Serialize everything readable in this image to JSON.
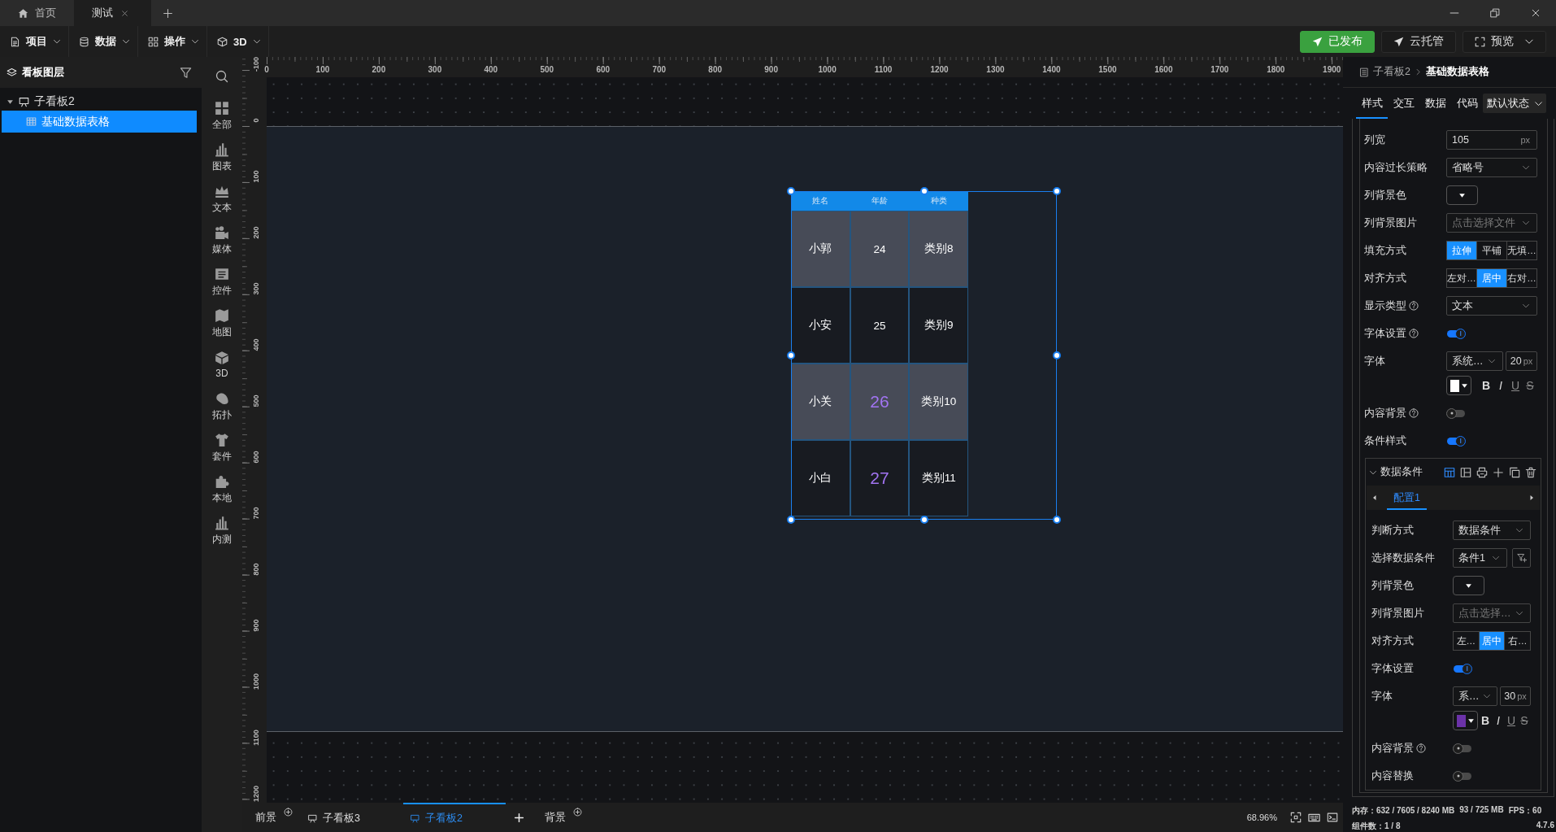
{
  "title_bar": {
    "tabs": [
      {
        "label": "首页",
        "selected": false,
        "closable": false
      },
      {
        "label": "测试",
        "selected": true,
        "closable": true
      }
    ]
  },
  "toolbar": {
    "menus": [
      {
        "label": "项目"
      },
      {
        "label": "数据"
      },
      {
        "label": "操作"
      },
      {
        "label": "3D"
      }
    ],
    "actions": [
      {
        "label": "已发布",
        "kind": "primary"
      },
      {
        "label": "云托管",
        "kind": "plain"
      },
      {
        "label": "预览",
        "kind": "dropdown"
      }
    ]
  },
  "layers_panel": {
    "title": "看板图层",
    "tree": [
      {
        "label": "子看板2",
        "expanded": true,
        "selected": false,
        "children": [
          {
            "label": "基础数据表格",
            "selected": true
          }
        ]
      }
    ]
  },
  "component_bar": {
    "items": [
      {
        "label": "全部"
      },
      {
        "label": "图表"
      },
      {
        "label": "文本"
      },
      {
        "label": "媒体"
      },
      {
        "label": "控件"
      },
      {
        "label": "地图"
      },
      {
        "label": "3D"
      },
      {
        "label": "拓扑"
      },
      {
        "label": "套件"
      },
      {
        "label": "本地"
      },
      {
        "label": "内测"
      }
    ]
  },
  "rulers": {
    "horizontal": [
      "0",
      "100",
      "200",
      "300",
      "400",
      "500",
      "600",
      "700",
      "800",
      "900",
      "1000",
      "1100",
      "1200",
      "1300",
      "1400",
      "1500",
      "1600",
      "1700",
      "1800",
      "1900"
    ],
    "vertical": [
      "-100",
      "0",
      "100",
      "200",
      "300",
      "400",
      "500",
      "600",
      "700",
      "800",
      "900",
      "1000",
      "1100",
      "1200"
    ]
  },
  "canvas": {
    "table": {
      "selected": true,
      "columns": [
        "姓名",
        "年龄",
        "种类"
      ],
      "rows": [
        {
          "cells": [
            {
              "text": "小郭",
              "conditional": false
            },
            {
              "text": "24",
              "conditional": false
            },
            {
              "text": "类别8",
              "conditional": false
            }
          ]
        },
        {
          "cells": [
            {
              "text": "小安",
              "conditional": false
            },
            {
              "text": "25",
              "conditional": false
            },
            {
              "text": "类别9",
              "conditional": false
            }
          ]
        },
        {
          "cells": [
            {
              "text": "小关",
              "conditional": false
            },
            {
              "text": "26",
              "conditional": true
            },
            {
              "text": "类别10",
              "conditional": false
            }
          ]
        },
        {
          "cells": [
            {
              "text": "小白",
              "conditional": false
            },
            {
              "text": "27",
              "conditional": true
            },
            {
              "text": "类别11",
              "conditional": false
            }
          ]
        }
      ]
    }
  },
  "inspector": {
    "breadcrumb": {
      "parent": "子看板2",
      "current": "基础数据表格"
    },
    "tabs": [
      {
        "label": "样式",
        "selected": true
      },
      {
        "label": "交互",
        "selected": false
      },
      {
        "label": "数据",
        "selected": false
      },
      {
        "label": "代码",
        "selected": false
      }
    ],
    "state_select": "默认状态",
    "fields": [
      {
        "kind": "number",
        "label": "列宽",
        "value": "105",
        "unit": "px"
      },
      {
        "kind": "select",
        "label": "内容过长策略",
        "value": "省略号"
      },
      {
        "kind": "color",
        "label": "列背景色"
      },
      {
        "kind": "select",
        "label": "列背景图片",
        "placeholder": "点击选择文件"
      },
      {
        "kind": "segmented",
        "label": "填充方式",
        "options": [
          {
            "label": "拉伸",
            "selected": true
          },
          {
            "label": "平铺",
            "selected": false
          },
          {
            "label": "无填…",
            "selected": false
          }
        ]
      },
      {
        "kind": "segmented",
        "label": "对齐方式",
        "options": [
          {
            "label": "左对…",
            "selected": false
          },
          {
            "label": "居中",
            "selected": true
          },
          {
            "label": "右对…",
            "selected": false
          }
        ]
      },
      {
        "kind": "select",
        "label": "显示类型",
        "help": true,
        "value": "文本"
      },
      {
        "kind": "toggle",
        "label": "字体设置",
        "help": true,
        "on": true
      },
      {
        "kind": "font",
        "label": "字体",
        "family": "系统…",
        "size": "20",
        "unit": "px",
        "color": "#ffffff",
        "styles": [
          {
            "label": "B",
            "kind": "bold"
          },
          {
            "label": "I",
            "kind": "italic"
          },
          {
            "label": "U",
            "kind": "underline"
          },
          {
            "label": "S",
            "kind": "strike"
          }
        ]
      },
      {
        "kind": "toggle",
        "label": "内容背景",
        "help": true,
        "on": false
      },
      {
        "kind": "toggle",
        "label": "条件样式",
        "on": true
      }
    ],
    "condition_section": {
      "title": "数据条件",
      "expanded": true,
      "layouts": [
        {
          "selected": true
        },
        {
          "selected": false
        }
      ],
      "tabs": [
        {
          "label": "配置1",
          "selected": true
        }
      ],
      "fields": [
        {
          "kind": "select",
          "label": "判断方式",
          "value": "数据条件"
        },
        {
          "kind": "select_button",
          "label": "选择数据条件",
          "value": "条件1"
        },
        {
          "kind": "color",
          "label": "列背景色"
        },
        {
          "kind": "select",
          "label": "列背景图片",
          "placeholder": "点击选择…"
        },
        {
          "kind": "segmented",
          "label": "对齐方式",
          "options": [
            {
              "label": "左…",
              "selected": false
            },
            {
              "label": "居中",
              "selected": true
            },
            {
              "label": "右…",
              "selected": false
            }
          ]
        },
        {
          "kind": "toggle",
          "label": "字体设置",
          "on": true
        },
        {
          "kind": "font",
          "label": "字体",
          "family": "系…",
          "size": "30",
          "unit": "px",
          "color": "#6b32a8",
          "styles": [
            {
              "label": "B",
              "kind": "bold"
            },
            {
              "label": "I",
              "kind": "italic"
            },
            {
              "label": "U",
              "kind": "underline"
            },
            {
              "label": "S",
              "kind": "strike"
            }
          ]
        },
        {
          "kind": "toggle",
          "label": "内容背景",
          "help": true,
          "on": false
        },
        {
          "kind": "toggle",
          "label": "内容替换",
          "on": false
        }
      ]
    }
  },
  "bottom_bar": {
    "front": {
      "label": "前景"
    },
    "boards": [
      {
        "label": "子看板3",
        "selected": false
      },
      {
        "label": "子看板2",
        "selected": true
      }
    ],
    "back": {
      "label": "背景"
    },
    "zoom": "68.96%"
  },
  "status": {
    "memory": "内存：632 / 7605 / 8240 MB",
    "gpu_memory": "93 / 725 MB",
    "fps": "FPS：60",
    "components": "组件数：1 / 8",
    "version": "4.7.6"
  }
}
